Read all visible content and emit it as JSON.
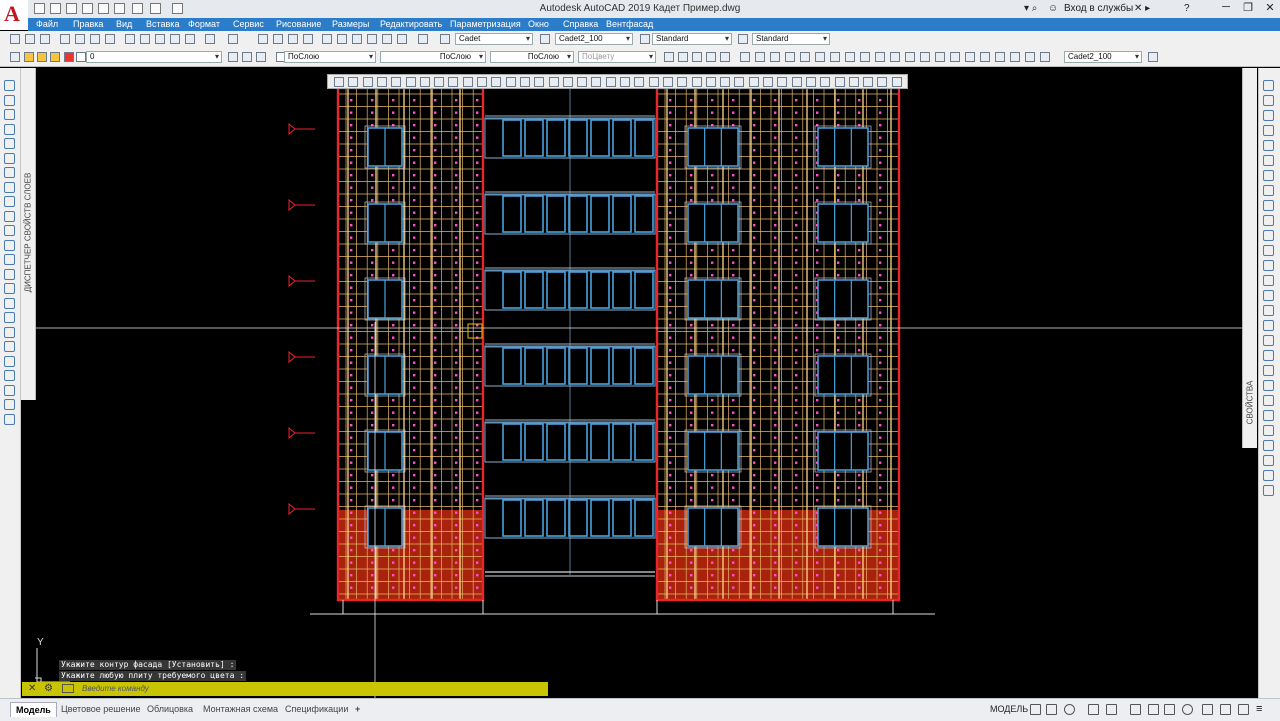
{
  "app": {
    "title": "Autodesk AutoCAD 2019    Кадет Пример.dwg",
    "logo_letter": "A",
    "login_label": "Вход в службы",
    "help_label": "?",
    "min": "─",
    "restore": "❐",
    "close": "✕"
  },
  "menu": [
    "Файл",
    "Правка",
    "Вид",
    "Вставка",
    "Формат",
    "Сервис",
    "Рисование",
    "Размеры",
    "Редактировать",
    "Параметризация",
    "Окно",
    "Справка",
    "Вентфасад"
  ],
  "toolbar": {
    "text_style": "Cadet",
    "dim_style": "Cadet2_100",
    "table_style": "Standard",
    "mleader_style": "Standard",
    "layer": "0",
    "color": "ПоСлою",
    "linetype": "ПоСлою",
    "lineweight": "ПоСлою",
    "plotstyle": "ПоЦвету",
    "annot_scale": "Cadet2_100"
  },
  "panels": {
    "layer_properties": "ДИСПЕТЧЕР СВОЙСТВ СЛОЕВ",
    "properties": "СВОЙСТВА"
  },
  "ucs": {
    "y_label": "Y"
  },
  "command": {
    "history": [
      "Укажите контур фасада [Установить] :",
      "Укажите любую плиту требуемого цвета :"
    ],
    "placeholder": "Введите команду"
  },
  "tabs": [
    "Модель",
    "Цветовое решение",
    "Облицовка",
    "Монтажная схема",
    "Спецификации"
  ],
  "add_tab": "+",
  "status": {
    "space": "МОДЕЛЬ"
  },
  "drawing": {
    "floors": 6,
    "window_columns": 4,
    "stair_window_panes": 7,
    "frame_color": "#e8262b",
    "grid_color": "#e8b86a",
    "window_color": "#4aa3df",
    "base_panel_color": "#a8220c",
    "marker_color": "#e8262b"
  }
}
